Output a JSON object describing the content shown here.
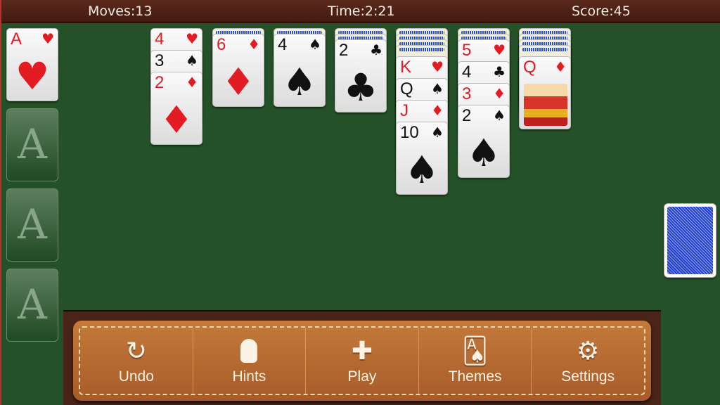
{
  "header": {
    "moves": "Moves:13",
    "time": "Time:2:21",
    "score": "Score:45"
  },
  "foundations": [
    {
      "rank": "A",
      "suit": "♥",
      "color": "red"
    },
    {
      "empty_label": "A"
    },
    {
      "empty_label": "A"
    },
    {
      "empty_label": "A"
    }
  ],
  "tableau": [
    {
      "facedown": 0,
      "cards": [
        {
          "rank": "4",
          "suit": "♥",
          "color": "red"
        },
        {
          "rank": "3",
          "suit": "♠",
          "color": "black"
        },
        {
          "rank": "2",
          "suit": "♦",
          "color": "red"
        }
      ]
    },
    {
      "facedown": 1,
      "cards": [
        {
          "rank": "6",
          "suit": "♦",
          "color": "red"
        }
      ]
    },
    {
      "facedown": 1,
      "cards": [
        {
          "rank": "4",
          "suit": "♠",
          "color": "black"
        }
      ]
    },
    {
      "facedown": 2,
      "cards": [
        {
          "rank": "2",
          "suit": "♣",
          "color": "black"
        }
      ]
    },
    {
      "facedown": 4,
      "cards": [
        {
          "rank": "K",
          "suit": "♥",
          "color": "red"
        },
        {
          "rank": "Q",
          "suit": "♠",
          "color": "black"
        },
        {
          "rank": "J",
          "suit": "♦",
          "color": "red"
        },
        {
          "rank": "10",
          "suit": "♠",
          "color": "black"
        }
      ]
    },
    {
      "facedown": 2,
      "cards": [
        {
          "rank": "5",
          "suit": "♥",
          "color": "red"
        },
        {
          "rank": "4",
          "suit": "♣",
          "color": "black"
        },
        {
          "rank": "3",
          "suit": "♦",
          "color": "red"
        },
        {
          "rank": "2",
          "suit": "♠",
          "color": "black"
        }
      ]
    },
    {
      "facedown": 4,
      "cards": [
        {
          "rank": "Q",
          "suit": "♦",
          "color": "red",
          "face": "queen"
        }
      ]
    }
  ],
  "toolbar": [
    {
      "label": "Undo",
      "icon": "undo-icon",
      "glyph": "↻"
    },
    {
      "label": "Hints",
      "icon": "lightbulb-icon",
      "glyph": "💡"
    },
    {
      "label": "Play",
      "icon": "plus-icon",
      "glyph": "✚"
    },
    {
      "label": "Themes",
      "icon": "cards-icon",
      "glyph": "🂡"
    },
    {
      "label": "Settings",
      "icon": "gear-icon",
      "glyph": "⚙"
    }
  ]
}
